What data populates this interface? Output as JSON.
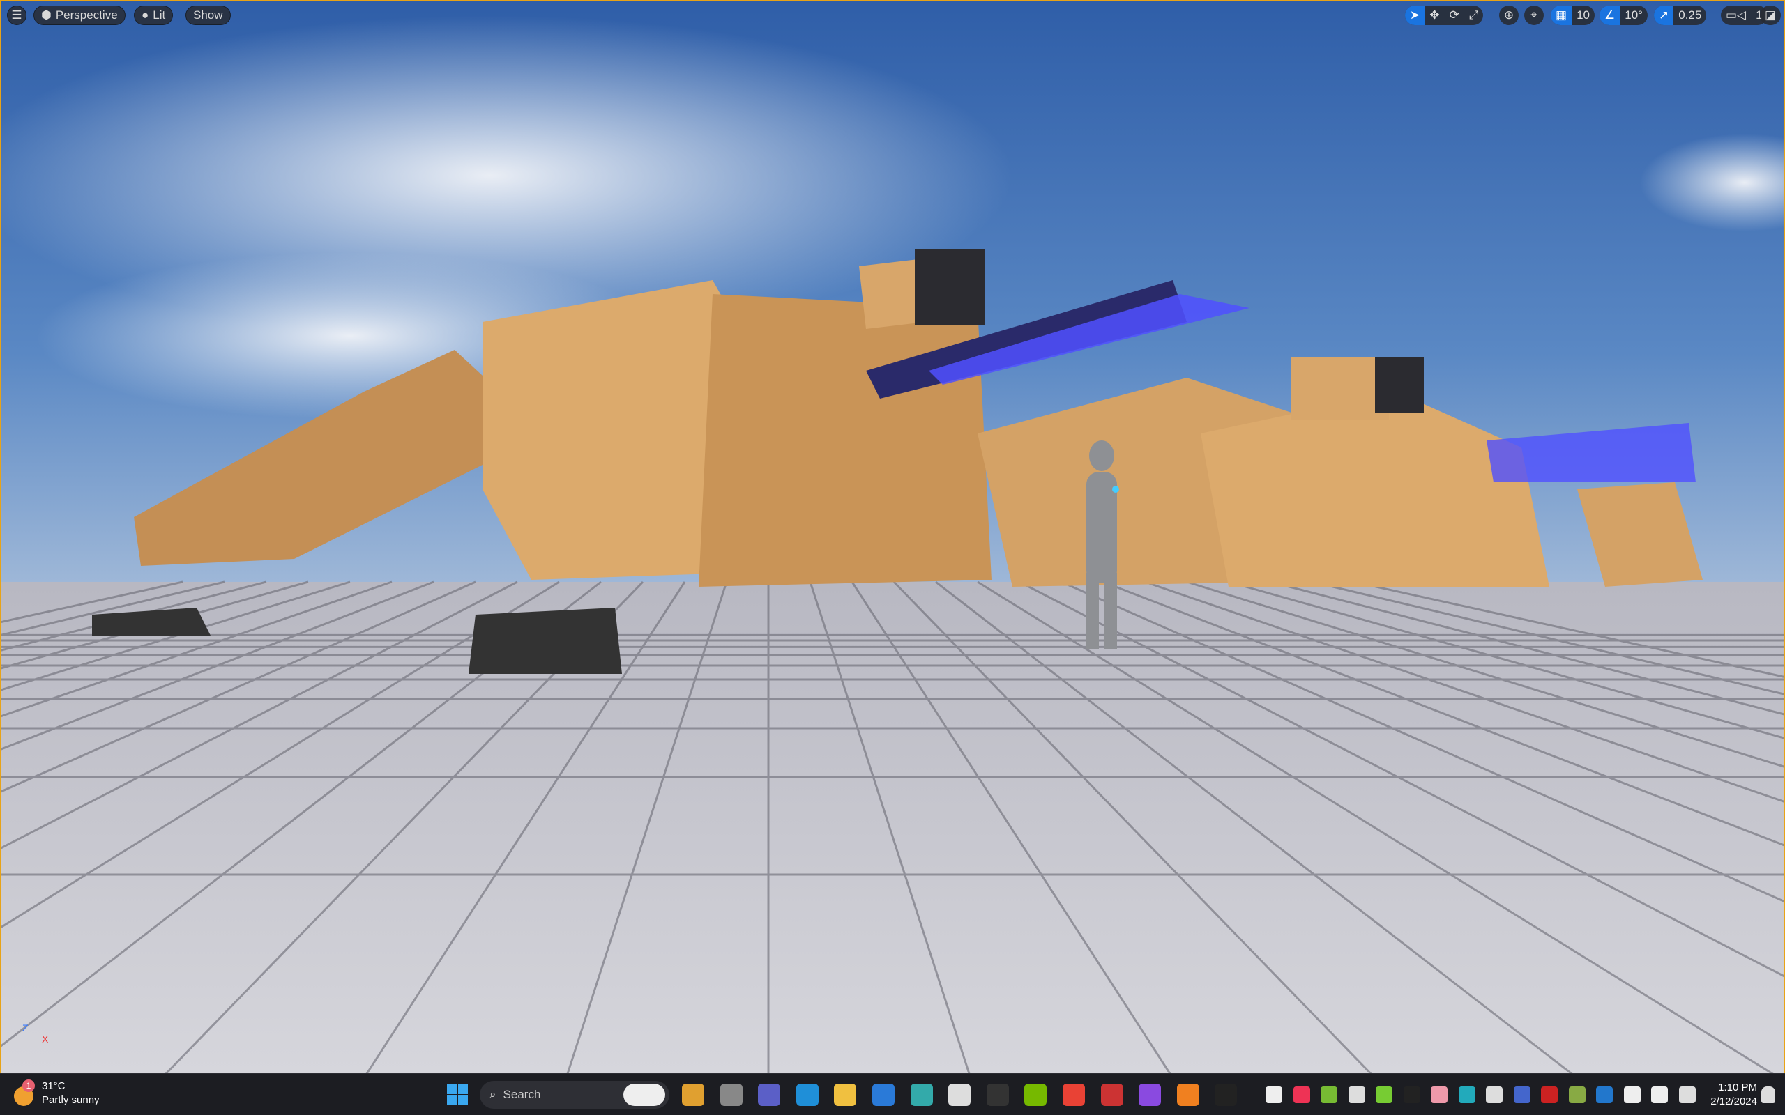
{
  "viewport_toolbar": {
    "menu_icon": "hamburger-icon",
    "view_mode": "Perspective",
    "lighting_mode": "Lit",
    "show_label": "Show",
    "grid_snap": "10",
    "rotation_snap": "10°",
    "scale_snap": "0.25",
    "camera_speed": "1"
  },
  "axis_gizmo": {
    "z": "Z",
    "x": "X"
  },
  "taskbar": {
    "weather_temp": "31°C",
    "weather_desc": "Partly sunny",
    "weather_badge": "1",
    "search_placeholder": "Search",
    "time": "1:10 PM",
    "date": "2/12/2024"
  },
  "colors": {
    "accent": "#1a74e0",
    "viewport_border": "#e8a317",
    "mech": "#d9a86a",
    "glow": "#4a4dff"
  }
}
